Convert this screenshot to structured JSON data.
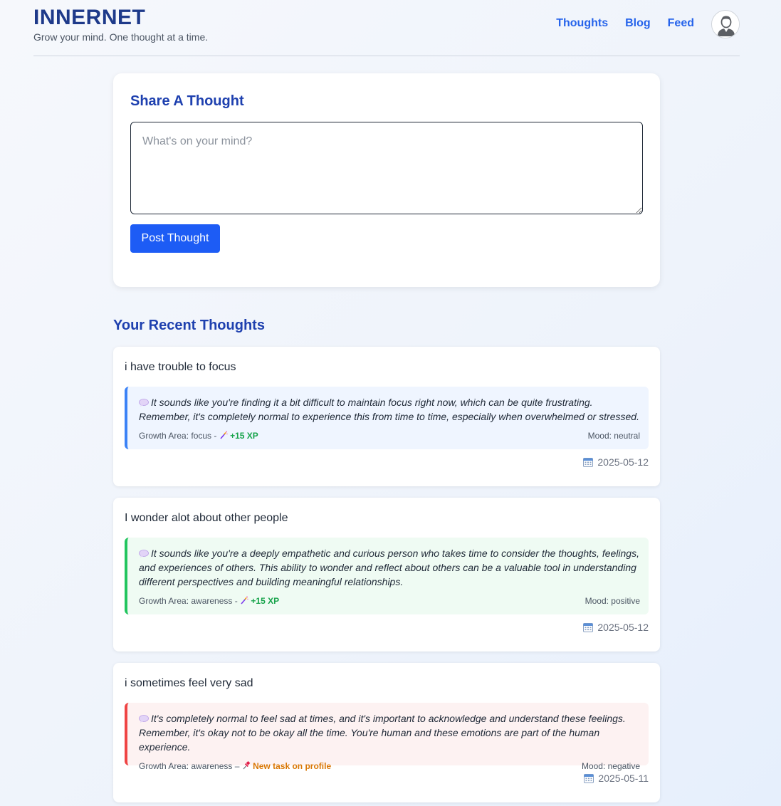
{
  "header": {
    "title": "INNERNET",
    "tagline": "Grow your mind. One thought at a time.",
    "nav": [
      {
        "label": "Thoughts"
      },
      {
        "label": "Blog"
      },
      {
        "label": "Feed"
      }
    ],
    "avatar_icon": "user-avatar-icon"
  },
  "share": {
    "title": "Share A Thought",
    "placeholder": "What's on your mind?",
    "value": "",
    "button_label": "Post Thought"
  },
  "recent": {
    "title": "Your Recent Thoughts",
    "items": [
      {
        "text": "i have trouble to focus",
        "reflection": "It sounds like you're finding it a bit difficult to maintain focus right now, which can be quite frustrating. Remember, it's completely normal to experience this from time to time, especially when overwhelmed or stressed.",
        "growth_area": "Growth Area: focus -",
        "reward": "+15 XP",
        "reward_icon": "magic-wand-icon",
        "mood": "Mood: neutral",
        "date": "2025-05-12",
        "accent": "#3b82f6"
      },
      {
        "text": "I wonder alot about other people",
        "reflection": "It sounds like you're a deeply empathetic and curious person who takes time to consider the thoughts, feelings, and experiences of others. This ability to wonder and reflect about others can be a valuable tool in understanding different perspectives and building meaningful relationships.",
        "growth_area": "Growth Area: awareness -",
        "reward": "+15 XP",
        "reward_icon": "magic-wand-icon",
        "mood": "Mood: positive",
        "date": "2025-05-12",
        "accent": "#22c55e"
      },
      {
        "text": "i sometimes feel very sad",
        "reflection": "It's completely normal to feel sad at times, and it's important to acknowledge and understand these feelings. Remember, it's okay not to be okay all the time. You're human and these emotions are part of the human experience.",
        "growth_area": "Growth Area: awareness –",
        "reward": "New task on profile",
        "reward_icon": "pushpin-icon",
        "mood": "Mood: negative",
        "date": "2025-05-11",
        "accent": "#ef4444"
      }
    ]
  },
  "colors": {
    "brand": "#1e3a8a",
    "link": "#2563eb",
    "primary_button": "#1d5cf5",
    "xp": "#16a34a",
    "task": "#d97706"
  }
}
